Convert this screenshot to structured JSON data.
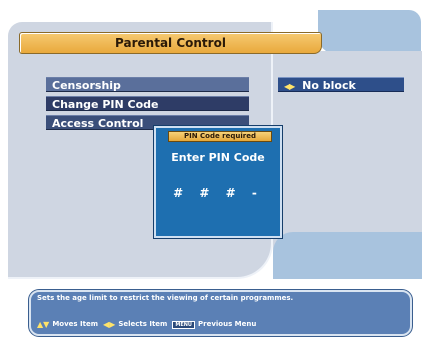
{
  "header": {
    "title": "Parental Control"
  },
  "menu": {
    "items": [
      {
        "label": "Censorship"
      },
      {
        "label": "Change PIN Code"
      },
      {
        "label": "Access Control"
      }
    ],
    "censorship_value": "No block"
  },
  "pin_dialog": {
    "title": "PIN Code required",
    "prompt": "Enter PIN Code",
    "digits": "# # # -"
  },
  "help": {
    "description": "Sets the age limit to restrict the viewing of certain programmes.",
    "legend": [
      {
        "icon": "up-down-arrows-icon",
        "label": "Moves Item"
      },
      {
        "icon": "left-right-arrows-icon",
        "label": "Selects Item"
      },
      {
        "icon": "menu-key-icon",
        "key_text": "MENU",
        "label": "Previous Menu"
      }
    ]
  },
  "colors": {
    "accent_gold": "#e9a93c",
    "menu_blue": "#3b4f7a",
    "dialog_blue": "#1e6fb0",
    "panel_gray": "#cfd6e2",
    "icon_yellow": "#ffe36a"
  }
}
